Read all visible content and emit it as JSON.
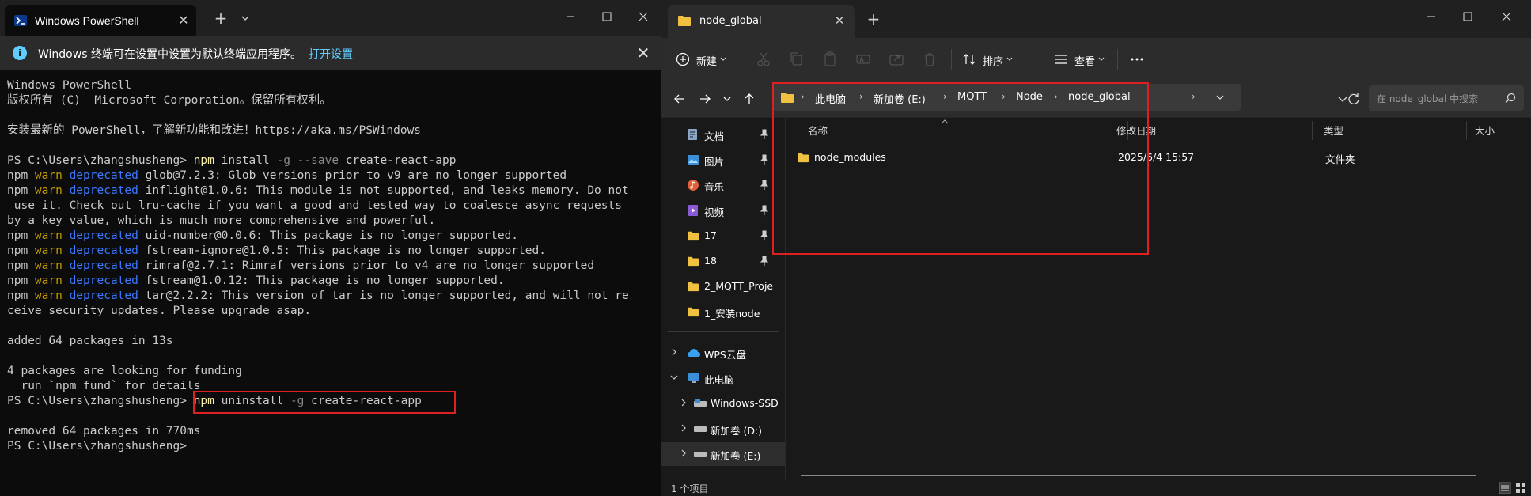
{
  "powershell": {
    "tab_title": "Windows PowerShell",
    "info_text": "Windows 终端可在设置中设置为默认终端应用程序。",
    "info_link": "打开设置",
    "lines": [
      [
        {
          "t": "Windows PowerShell",
          "c": "plain"
        }
      ],
      [
        {
          "t": "版权所有 (C)  Microsoft Corporation。保留所有权利。",
          "c": "plain"
        }
      ],
      [
        {
          "t": "",
          "c": "plain"
        }
      ],
      [
        {
          "t": "安装最新的 PowerShell，了解新功能和改进！https://aka.ms/PSWindows",
          "c": "plain"
        }
      ],
      [
        {
          "t": "",
          "c": "plain"
        }
      ],
      [
        {
          "t": "PS C:\\Users\\zhangshusheng> ",
          "c": "plain"
        },
        {
          "t": "npm",
          "c": "cmd"
        },
        {
          "t": " install ",
          "c": "plain"
        },
        {
          "t": "-g --save",
          "c": "flag"
        },
        {
          "t": " create-react-app",
          "c": "plain"
        }
      ],
      [
        {
          "t": "npm ",
          "c": "npm"
        },
        {
          "t": "warn",
          "c": "warn"
        },
        {
          "t": " ",
          "c": "plain"
        },
        {
          "t": "deprecated",
          "c": "dep"
        },
        {
          "t": " glob@7.2.3: Glob versions prior to v9 are no longer supported",
          "c": "plain"
        }
      ],
      [
        {
          "t": "npm ",
          "c": "npm"
        },
        {
          "t": "warn",
          "c": "warn"
        },
        {
          "t": " ",
          "c": "plain"
        },
        {
          "t": "deprecated",
          "c": "dep"
        },
        {
          "t": " inflight@1.0.6: This module is not supported, and leaks memory. Do not",
          "c": "plain"
        }
      ],
      [
        {
          "t": " use it. Check out lru-cache if you want a good and tested way to coalesce async requests",
          "c": "plain"
        }
      ],
      [
        {
          "t": "by a key value, which is much more comprehensive and powerful.",
          "c": "plain"
        }
      ],
      [
        {
          "t": "npm ",
          "c": "npm"
        },
        {
          "t": "warn",
          "c": "warn"
        },
        {
          "t": " ",
          "c": "plain"
        },
        {
          "t": "deprecated",
          "c": "dep"
        },
        {
          "t": " uid-number@0.0.6: This package is no longer supported.",
          "c": "plain"
        }
      ],
      [
        {
          "t": "npm ",
          "c": "npm"
        },
        {
          "t": "warn",
          "c": "warn"
        },
        {
          "t": " ",
          "c": "plain"
        },
        {
          "t": "deprecated",
          "c": "dep"
        },
        {
          "t": " fstream-ignore@1.0.5: This package is no longer supported.",
          "c": "plain"
        }
      ],
      [
        {
          "t": "npm ",
          "c": "npm"
        },
        {
          "t": "warn",
          "c": "warn"
        },
        {
          "t": " ",
          "c": "plain"
        },
        {
          "t": "deprecated",
          "c": "dep"
        },
        {
          "t": " rimraf@2.7.1: Rimraf versions prior to v4 are no longer supported",
          "c": "plain"
        }
      ],
      [
        {
          "t": "npm ",
          "c": "npm"
        },
        {
          "t": "warn",
          "c": "warn"
        },
        {
          "t": " ",
          "c": "plain"
        },
        {
          "t": "deprecated",
          "c": "dep"
        },
        {
          "t": " fstream@1.0.12: This package is no longer supported.",
          "c": "plain"
        }
      ],
      [
        {
          "t": "npm ",
          "c": "npm"
        },
        {
          "t": "warn",
          "c": "warn"
        },
        {
          "t": " ",
          "c": "plain"
        },
        {
          "t": "deprecated",
          "c": "dep"
        },
        {
          "t": " tar@2.2.2: This version of tar is no longer supported, and will not re",
          "c": "plain"
        }
      ],
      [
        {
          "t": "ceive security updates. Please upgrade asap.",
          "c": "plain"
        }
      ],
      [
        {
          "t": "",
          "c": "plain"
        }
      ],
      [
        {
          "t": "added 64 packages in 13s",
          "c": "plain"
        }
      ],
      [
        {
          "t": "",
          "c": "plain"
        }
      ],
      [
        {
          "t": "4 packages are looking for funding",
          "c": "plain"
        }
      ],
      [
        {
          "t": "  run `npm fund` for details",
          "c": "plain"
        }
      ],
      [
        {
          "t": "PS C:\\Users\\zhangshusheng> ",
          "c": "plain"
        },
        {
          "t": "npm",
          "c": "cmd"
        },
        {
          "t": " uninstall ",
          "c": "plain"
        },
        {
          "t": "-g",
          "c": "flag"
        },
        {
          "t": " create-react-app",
          "c": "plain"
        }
      ],
      [
        {
          "t": "",
          "c": "plain"
        }
      ],
      [
        {
          "t": "removed 64 packages in 770ms",
          "c": "plain"
        }
      ],
      [
        {
          "t": "PS C:\\Users\\zhangshusheng>",
          "c": "plain"
        }
      ]
    ]
  },
  "explorer": {
    "tab_title": "node_global",
    "toolbar": {
      "new_label": "新建",
      "sort_label": "排序",
      "view_label": "查看"
    },
    "breadcrumbs": [
      "此电脑",
      "新加卷 (E:)",
      "MQTT",
      "Node",
      "node_global"
    ],
    "search_placeholder": "在 node_global 中搜索",
    "nav": {
      "pinned": [
        {
          "label": "文档",
          "icon": "document-icon"
        },
        {
          "label": "图片",
          "icon": "pictures-icon"
        },
        {
          "label": "音乐",
          "icon": "music-icon"
        },
        {
          "label": "视频",
          "icon": "video-icon"
        },
        {
          "label": "17",
          "icon": "folder-icon"
        },
        {
          "label": "18",
          "icon": "folder-icon"
        }
      ],
      "recent": [
        {
          "label": "2_MQTT_Proje",
          "icon": "folder-icon"
        },
        {
          "label": "1_安装node",
          "icon": "folder-icon"
        }
      ],
      "wps": "WPS云盘",
      "this_pc": "此电脑",
      "drives": [
        {
          "label": "Windows-SSD"
        },
        {
          "label": "新加卷 (D:)"
        },
        {
          "label": "新加卷 (E:)"
        }
      ]
    },
    "columns": {
      "name": "名称",
      "modified": "修改日期",
      "type": "类型",
      "size": "大小"
    },
    "files": [
      {
        "name": "node_modules",
        "modified": "2025/6/4 15:57",
        "type": "文件夹",
        "icon": "folder-icon"
      }
    ],
    "status": "1 个项目"
  },
  "colors": {
    "highlight": "#e02020",
    "accent": "#60cdff",
    "folder": "#f0c040"
  }
}
